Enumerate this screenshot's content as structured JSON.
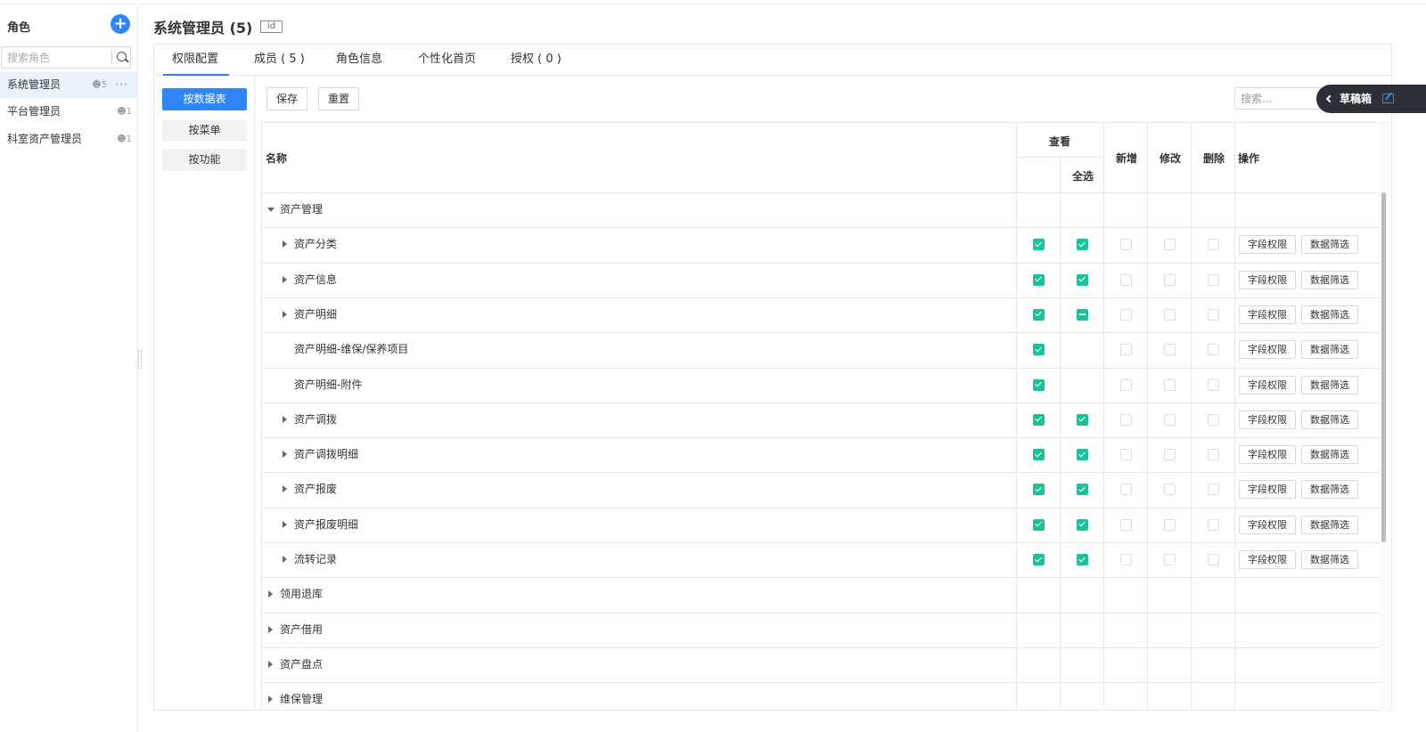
{
  "sidebar": {
    "title": "角色",
    "search_placeholder": "搜索角色",
    "roles": [
      {
        "name": "系统管理员",
        "count": "5"
      },
      {
        "name": "平台管理员",
        "count": "1"
      },
      {
        "name": "科室资产管理员",
        "count": "1"
      }
    ],
    "more": "···"
  },
  "header": {
    "title": "系统管理员 (5)",
    "id_badge": "id"
  },
  "tabs": [
    "权限配置",
    "成员 ( 5 )",
    "角色信息",
    "个性化首页",
    "授权 ( 0 )"
  ],
  "side_menu": [
    "按数据表",
    "按菜单",
    "按功能"
  ],
  "toolbar": {
    "save": "保存",
    "reset": "重置",
    "search_placeholder": "搜索...",
    "draft": "草稿箱"
  },
  "table": {
    "headers": {
      "name": "名称",
      "view": "查看",
      "select_all": "全选",
      "add": "新增",
      "edit": "修改",
      "delete": "删除",
      "actions": "操作"
    },
    "action_labels": {
      "field": "字段权限",
      "filter": "数据筛选"
    },
    "rows": [
      {
        "label": "资产管理",
        "level": 0,
        "expand": "open",
        "view": null,
        "all": null,
        "add": null,
        "edit": null,
        "del": null,
        "actions": false
      },
      {
        "label": "资产分类",
        "level": 1,
        "expand": "closed",
        "view": "on",
        "all": "on",
        "add": "off",
        "edit": "off",
        "del": "off",
        "actions": true
      },
      {
        "label": "资产信息",
        "level": 1,
        "expand": "closed",
        "view": "on",
        "all": "on",
        "add": "off",
        "edit": "off",
        "del": "off",
        "actions": true
      },
      {
        "label": "资产明细",
        "level": 1,
        "expand": "closed",
        "view": "on",
        "all": "ind",
        "add": "off",
        "edit": "off",
        "del": "off",
        "actions": true
      },
      {
        "label": "资产明细-维保/保养项目",
        "level": 1,
        "expand": "none",
        "view": "on",
        "all": null,
        "add": "off",
        "edit": "off",
        "del": "off",
        "actions": true
      },
      {
        "label": "资产明细-附件",
        "level": 1,
        "expand": "none",
        "view": "on",
        "all": null,
        "add": "off",
        "edit": "off",
        "del": "off",
        "actions": true
      },
      {
        "label": "资产调拨",
        "level": 1,
        "expand": "closed",
        "view": "on",
        "all": "on",
        "add": "off",
        "edit": "off",
        "del": "off",
        "actions": true
      },
      {
        "label": "资产调拨明细",
        "level": 1,
        "expand": "closed",
        "view": "on",
        "all": "on",
        "add": "off",
        "edit": "off",
        "del": "off",
        "actions": true
      },
      {
        "label": "资产报废",
        "level": 1,
        "expand": "closed",
        "view": "on",
        "all": "on",
        "add": "off",
        "edit": "off",
        "del": "off",
        "actions": true
      },
      {
        "label": "资产报废明细",
        "level": 1,
        "expand": "closed",
        "view": "on",
        "all": "on",
        "add": "off",
        "edit": "off",
        "del": "off",
        "actions": true
      },
      {
        "label": "流转记录",
        "level": 1,
        "expand": "closed",
        "view": "on",
        "all": "on",
        "add": "off",
        "edit": "off",
        "del": "off",
        "actions": true
      },
      {
        "label": "领用退库",
        "level": 0,
        "expand": "closed",
        "view": null,
        "all": null,
        "add": null,
        "edit": null,
        "del": null,
        "actions": false
      },
      {
        "label": "资产借用",
        "level": 0,
        "expand": "closed",
        "view": null,
        "all": null,
        "add": null,
        "edit": null,
        "del": null,
        "actions": false
      },
      {
        "label": "资产盘点",
        "level": 0,
        "expand": "closed",
        "view": null,
        "all": null,
        "add": null,
        "edit": null,
        "del": null,
        "actions": false
      },
      {
        "label": "维保管理",
        "level": 0,
        "expand": "closed",
        "view": null,
        "all": null,
        "add": null,
        "edit": null,
        "del": null,
        "actions": false
      }
    ]
  },
  "colors": {
    "accent": "#2f86f6",
    "check": "#1cc09a"
  }
}
